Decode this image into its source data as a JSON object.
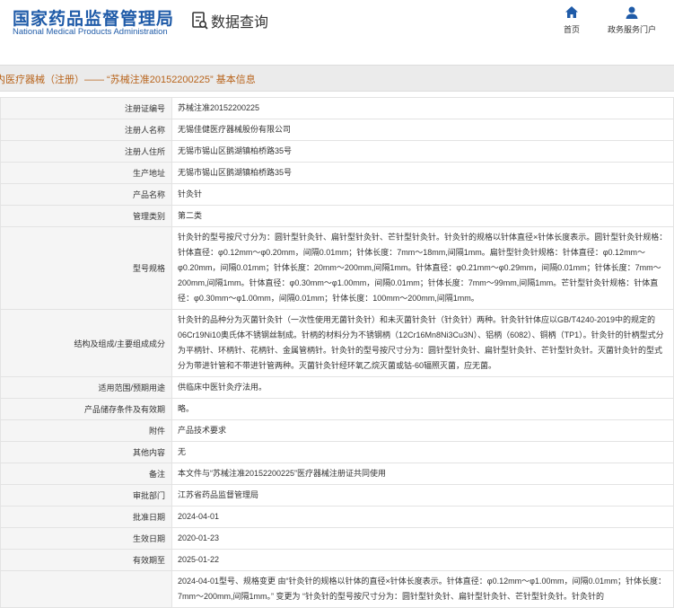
{
  "header": {
    "logo_cn": "国家药品监督管理局",
    "logo_en": "National Medical Products Administration",
    "query_label": "数据查询",
    "nav": [
      {
        "label": "首页",
        "icon": "home-icon"
      },
      {
        "label": "政务服务门户",
        "icon": "user-icon"
      }
    ]
  },
  "colors": {
    "brand": "#1f5ba8",
    "title_text": "#b8641c",
    "label_bg": "#f5f5f5"
  },
  "title": "内医疗器械（注册）—— “苏械注准20152200225” 基本信息",
  "rows": [
    {
      "label": "注册证编号",
      "value": "苏械注准20152200225"
    },
    {
      "label": "注册人名称",
      "value": "无锡佳健医疗器械股份有限公司"
    },
    {
      "label": "注册人住所",
      "value": "无锡市锡山区鹅湖镇柏桥路35号"
    },
    {
      "label": "生产地址",
      "value": "无锡市锡山区鹅湖镇柏桥路35号"
    },
    {
      "label": "产品名称",
      "value": "针灸针"
    },
    {
      "label": "管理类别",
      "value": "第二类"
    },
    {
      "label": "型号规格",
      "value": "针灸针的型号按尺寸分为：圆针型针灸针、扁针型针灸针、芒针型针灸针。针灸针的规格以针体直径×针体长度表示。圆针型针灸针规格：针体直径：φ0.12mm～φ0.20mm，间隔0.01mm；针体长度：7mm～18mm,间隔1mm。扁针型针灸针规格：针体直径：φ0.12mm～φ0.20mm，间隔0.01mm；针体长度：20mm～200mm,间隔1mm。针体直径：φ0.21mm～φ0.29mm，间隔0.01mm；针体长度：7mm～200mm,间隔1mm。针体直径：φ0.30mm～φ1.00mm，间隔0.01mm；针体长度：7mm～99mm,间隔1mm。芒针型针灸针规格：针体直径：φ0.30mm～φ1.00mm，间隔0.01mm；针体长度：100mm～200mm,间隔1mm。"
    },
    {
      "label": "结构及组成/主要组成成分",
      "value": "针灸针的品种分为灭菌针灸针（一次性使用无菌针灸针）和未灭菌针灸针（针灸针）两种。针灸针针体应以GB/T4240-2019中的规定的06Cr19Ni10奥氏体不锈钢丝制成。针柄的材料分为不锈钢柄（12Cr16Mn8Ni3Cu3N）、铝柄（6082）、铜柄（TP1）。针灸针的针柄型式分为平柄针、环柄针、花柄针、金属管柄针。针灸针的型号按尺寸分为：圆针型针灸针、扁针型针灸针、芒针型针灸针。灭菌针灸针的型式分为带进针管和不带进针管两种。灭菌针灸针经环氧乙烷灭菌或钴-60辐照灭菌，应无菌。"
    },
    {
      "label": "适用范围/预期用途",
      "value": "供临床中医针灸疗法用。"
    },
    {
      "label": "产品储存条件及有效期",
      "value": "略。"
    },
    {
      "label": "附件",
      "value": "产品技术要求"
    },
    {
      "label": "其他内容",
      "value": "无"
    },
    {
      "label": "备注",
      "value": "本文件与“苏械注准20152200225”医疗器械注册证共同使用"
    },
    {
      "label": "审批部门",
      "value": "江苏省药品监督管理局"
    },
    {
      "label": "批准日期",
      "value": "2024-04-01"
    },
    {
      "label": "生效日期",
      "value": "2020-01-23"
    },
    {
      "label": "有效期至",
      "value": "2025-01-22"
    },
    {
      "label": "",
      "value": "2024-04-01型号、规格变更 由“针灸针的规格以针体的直径×针体长度表示。针体直径：φ0.12mm～φ1.00mm，间隔0.01mm；针体长度：7mm～200mm,间隔1mm。” 变更为 “针灸针的型号按尺寸分为：圆针型针灸针、扁针型针灸针、芒针型针灸针。针灸针的"
    }
  ]
}
